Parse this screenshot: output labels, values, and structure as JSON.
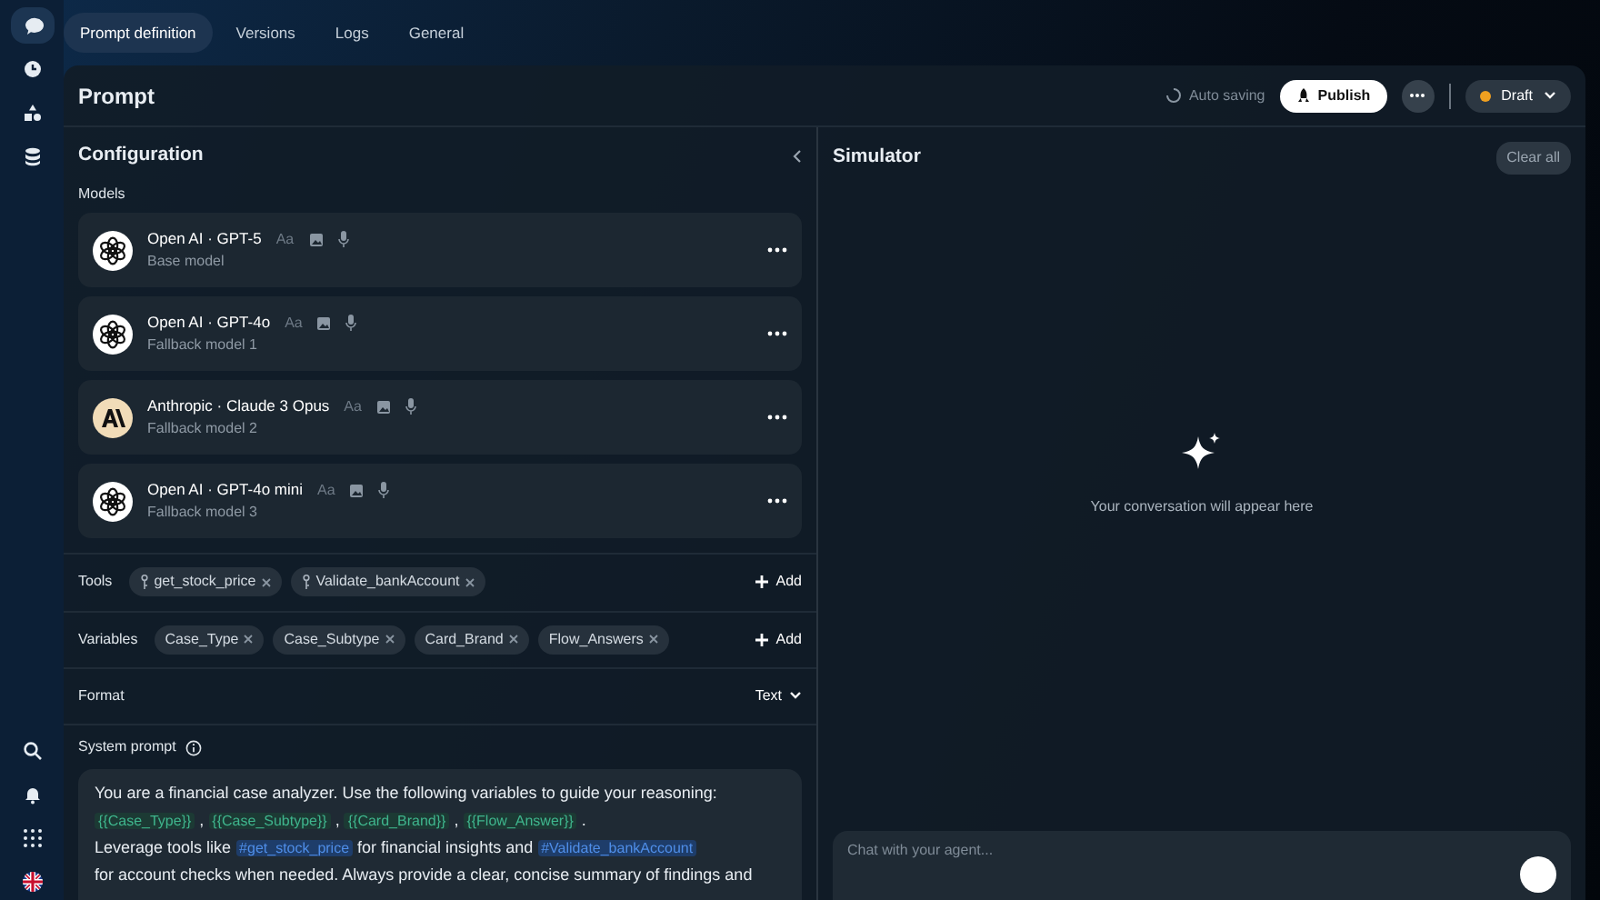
{
  "rail": {
    "top": [
      {
        "selected": true
      },
      {
        "selected": false
      },
      {
        "selected": false
      },
      {
        "selected": false
      }
    ],
    "bottom": [
      {
        "selected": false
      },
      {
        "selected": false
      },
      {
        "selected": false
      },
      {
        "selected": false
      }
    ]
  },
  "tabs": [
    {
      "label": "Prompt definition",
      "selected": true
    },
    {
      "label": "Versions",
      "selected": false
    },
    {
      "label": "Logs",
      "selected": false
    },
    {
      "label": "General",
      "selected": false
    }
  ],
  "header": {
    "title": "Prompt",
    "saving_status": "Auto saving",
    "publish_button": "Publish",
    "status_menu": "Draft"
  },
  "configuration": {
    "title": "Configuration",
    "models_label": "Models",
    "models": [
      {
        "kind": "openai",
        "name": "Open AI · GPT-5",
        "role": "Base model",
        "capability_text": "Aa"
      },
      {
        "kind": "openai",
        "name": "Open AI · GPT-4o",
        "role": "Fallback model 1",
        "capability_text": "Aa"
      },
      {
        "kind": "anthropic",
        "name": "Anthropic · Claude 3 Opus",
        "role": "Fallback model 2",
        "capability_text": "Aa"
      },
      {
        "kind": "openai",
        "name": "Open AI · GPT-4o mini",
        "role": "Fallback model 3",
        "capability_text": "Aa"
      }
    ],
    "tools": {
      "label": "Tools",
      "chips": [
        "get_stock_price",
        "Validate_bankAccount"
      ],
      "add_button": "Add"
    },
    "variables": {
      "label": "Variables",
      "chips": [
        "Case_Type",
        "Case_Subtype",
        "Card_Brand",
        "Flow_Answers"
      ],
      "add_button": "Add"
    },
    "format": {
      "label": "Format",
      "value": "Text"
    },
    "system_prompt": {
      "label": "System prompt",
      "lines": [
        [
          {
            "kind": "text",
            "text": "You are a financial case analyzer. Use the following variables to guide your reasoning:"
          }
        ],
        [
          {
            "kind": "variable",
            "text": "{{Case_Type}}"
          },
          {
            "kind": "text",
            "text": " , "
          },
          {
            "kind": "variable",
            "text": "{{Case_Subtype}}"
          },
          {
            "kind": "text",
            "text": " , "
          },
          {
            "kind": "variable",
            "text": "{{Card_Brand}}"
          },
          {
            "kind": "text",
            "text": " , "
          },
          {
            "kind": "variable",
            "text": "{{Flow_Answer}}"
          },
          {
            "kind": "text",
            "text": " ."
          }
        ],
        [
          {
            "kind": "text",
            "text": "Leverage tools like "
          },
          {
            "kind": "tool",
            "text": "#get_stock_price"
          },
          {
            "kind": "text",
            "text": " for financial insights and "
          },
          {
            "kind": "tool",
            "text": "#Validate_bankAccount"
          }
        ],
        [
          {
            "kind": "text",
            "text": "for account checks when needed. Always provide a clear, concise summary of findings and"
          }
        ]
      ]
    }
  },
  "simulator": {
    "title": "Simulator",
    "clear_button": "Clear all",
    "empty_message": "Your conversation will appear here",
    "chat_input": {
      "placeholder": "Chat with your agent..."
    }
  }
}
